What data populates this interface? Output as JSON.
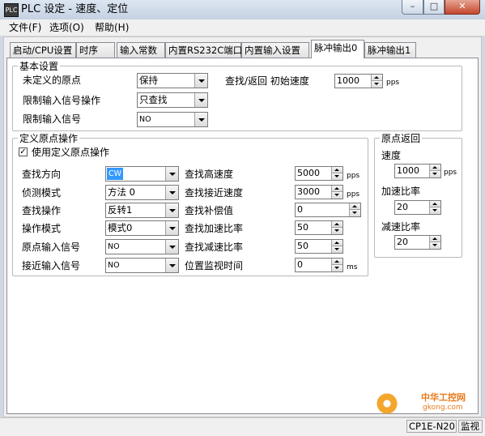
{
  "window": {
    "icon_text": "PLC",
    "title": "PLC 设定 - 速度、定位",
    "min_glyph": "–",
    "max_glyph": "□",
    "close_glyph": "✕"
  },
  "menu": [
    "文件(F)",
    "选项(O)",
    "帮助(H)"
  ],
  "tabs": [
    "启动/CPU设置",
    "时序",
    "输入常数",
    "内置RS232C端口",
    "内置输入设置",
    "脉冲输出0",
    "脉冲输出1"
  ],
  "active_tab": "脉冲输出0",
  "basic": {
    "title": "基本设置",
    "undefined_origin_label": "未定义的原点",
    "undefined_origin_value": "保持",
    "limit_op_label": "限制输入信号操作",
    "limit_op_value": "只查找",
    "limit_signal_label": "限制输入信号",
    "limit_signal_value": "NO",
    "search_return_label": "查找/返回 初始速度",
    "search_return_value": "1000",
    "search_return_unit": "pps"
  },
  "origin_define": {
    "title": "定义原点操作",
    "use_checkbox_label": "使用定义原点操作",
    "use_checked": true,
    "left_rows": [
      {
        "label": "查找方向",
        "value": "CW"
      },
      {
        "label": "侦测模式",
        "value": "方法 0"
      },
      {
        "label": "查找操作",
        "value": "反转1"
      },
      {
        "label": "操作模式",
        "value": "模式0"
      },
      {
        "label": "原点输入信号",
        "value": "NO"
      },
      {
        "label": "接近输入信号",
        "value": "NO"
      }
    ],
    "right_rows": [
      {
        "label": "查找高速度",
        "value": "5000",
        "unit": "pps"
      },
      {
        "label": "查找接近速度",
        "value": "3000",
        "unit": "pps"
      },
      {
        "label": "查找补偿值",
        "value": "0",
        "unit": ""
      },
      {
        "label": "查找加速比率",
        "value": "50",
        "unit": ""
      },
      {
        "label": "查找减速比率",
        "value": "50",
        "unit": ""
      },
      {
        "label": "位置监视时间",
        "value": "0",
        "unit": "ms"
      }
    ]
  },
  "origin_return": {
    "title": "原点返回",
    "speed_label": "速度",
    "speed_value": "1000",
    "speed_unit": "pps",
    "accel_label": "加速比率",
    "accel_value": "20",
    "decel_label": "减速比率",
    "decel_value": "20"
  },
  "watermark": {
    "text": "中华工控网",
    "url": "gkong.com"
  },
  "status": {
    "model": "CP1E-N20",
    "mode": "监视"
  },
  "colors": {
    "selection": "#3399ff",
    "window_frame": "#cfd8e4",
    "close_button": "#c4472d"
  }
}
